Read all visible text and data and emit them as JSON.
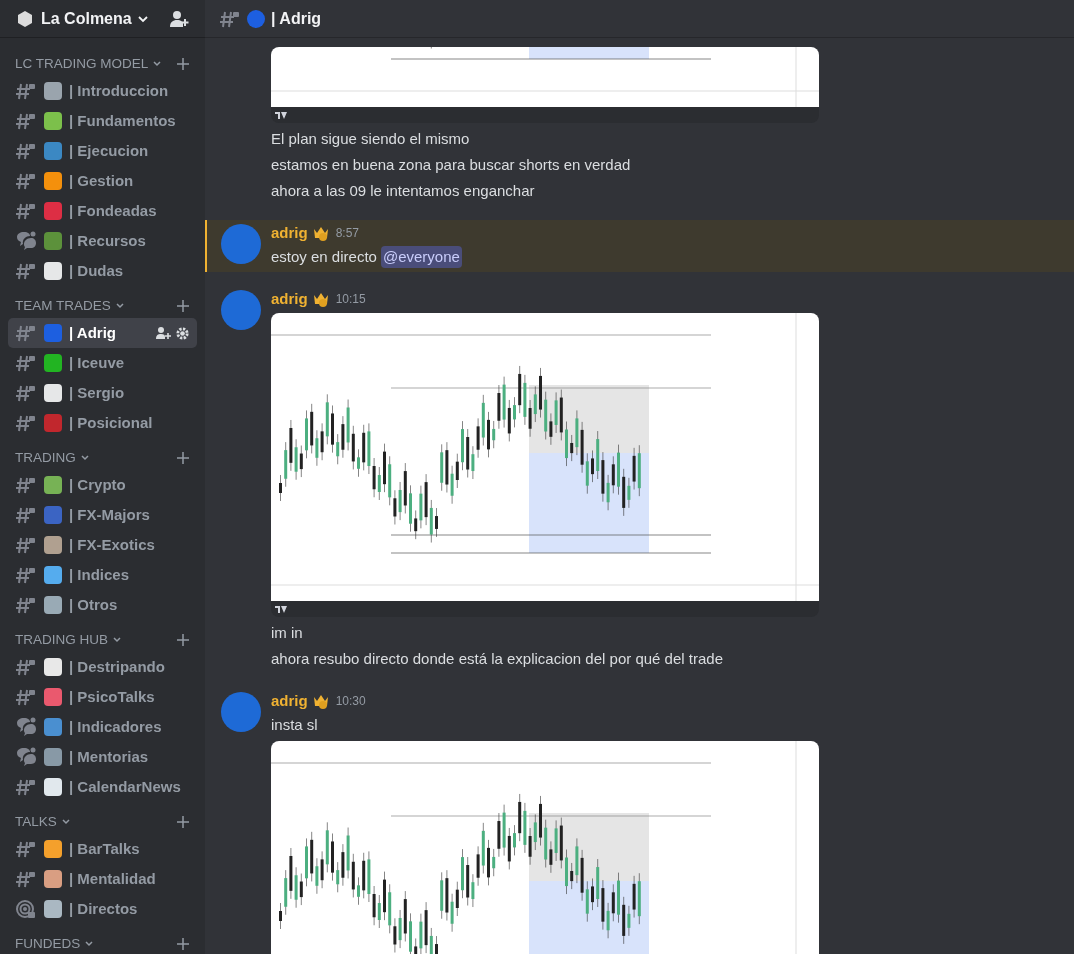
{
  "server": {
    "name": "La Colmena"
  },
  "categories": [
    {
      "name": "LC TRADING MODEL",
      "channels": [
        {
          "name": "| Introduccion",
          "kind": "text",
          "color": "#9aa4ad",
          "selected": false
        },
        {
          "name": "| Fundamentos",
          "kind": "text",
          "color": "#7cc04b",
          "selected": false
        },
        {
          "name": "| Ejecucion",
          "kind": "text",
          "color": "#3b88c3",
          "selected": false
        },
        {
          "name": "| Gestion",
          "kind": "text",
          "color": "#f4900c",
          "selected": false
        },
        {
          "name": "| Fondeadas",
          "kind": "text",
          "color": "#dd2e44",
          "selected": false
        },
        {
          "name": "| Recursos",
          "kind": "forum",
          "color": "#5c913b",
          "selected": false
        },
        {
          "name": "| Dudas",
          "kind": "text",
          "color": "#e6e7e8",
          "selected": false
        }
      ]
    },
    {
      "name": "TEAM TRADES",
      "channels": [
        {
          "name": "| Adrig",
          "kind": "text",
          "color": "#1d5fe0",
          "selected": true
        },
        {
          "name": "| Iceuve",
          "kind": "text",
          "color": "#22b422",
          "selected": false
        },
        {
          "name": "| Sergio",
          "kind": "text",
          "color": "#e6e7e8",
          "selected": false
        },
        {
          "name": "| Posicional",
          "kind": "text",
          "color": "#c1272d",
          "selected": false
        }
      ]
    },
    {
      "name": "TRADING",
      "channels": [
        {
          "name": "| Crypto",
          "kind": "text",
          "color": "#77b255",
          "selected": false
        },
        {
          "name": "| FX-Majors",
          "kind": "text",
          "color": "#3b64c3",
          "selected": false
        },
        {
          "name": "| FX-Exotics",
          "kind": "text",
          "color": "#b0a090",
          "selected": false
        },
        {
          "name": "| Indices",
          "kind": "text",
          "color": "#55acee",
          "selected": false
        },
        {
          "name": "| Otros",
          "kind": "text",
          "color": "#99aab5",
          "selected": false
        }
      ]
    },
    {
      "name": "TRADING HUB",
      "channels": [
        {
          "name": "| Destripando",
          "kind": "text",
          "color": "#e8e8e8",
          "selected": false
        },
        {
          "name": "| PsicoTalks",
          "kind": "text",
          "color": "#ea596e",
          "selected": false
        },
        {
          "name": "| Indicadores",
          "kind": "forum",
          "color": "#4a8fd0",
          "selected": false
        },
        {
          "name": "| Mentorias",
          "kind": "forum",
          "color": "#8899a6",
          "selected": false
        },
        {
          "name": "| CalendarNews",
          "kind": "text",
          "color": "#e1e8ed",
          "selected": false
        }
      ]
    },
    {
      "name": "TALKS",
      "channels": [
        {
          "name": "| BarTalks",
          "kind": "text",
          "color": "#f4a02c",
          "selected": false
        },
        {
          "name": "| Mentalidad",
          "kind": "text",
          "color": "#d99e82",
          "selected": false
        },
        {
          "name": "| Directos",
          "kind": "stage",
          "color": "#aab8c2",
          "selected": false
        }
      ]
    },
    {
      "name": "FUNDEDS"
    }
  ],
  "header": {
    "channel": "| Adrig",
    "kind": "text",
    "color": "#1d5fe0"
  },
  "messages": [
    {
      "kind": "continuation",
      "blocks": [
        {
          "kind": "partial_chart"
        },
        {
          "kind": "text",
          "text": "El plan sigue siendo el mismo"
        },
        {
          "kind": "text",
          "text": "estamos en buena zona para buscar shorts en verdad"
        },
        {
          "kind": "text",
          "text": "ahora a las 09 le intentamos enganchar"
        }
      ]
    },
    {
      "kind": "full",
      "author": "adrig",
      "time": "8:57",
      "mentioned": true,
      "blocks": [
        {
          "kind": "text",
          "text": "estoy en directo",
          "mention": "@everyone"
        }
      ]
    },
    {
      "kind": "full",
      "author": "adrig",
      "time": "10:15",
      "blocks": [
        {
          "kind": "chart"
        },
        {
          "kind": "text",
          "text": "im in"
        },
        {
          "kind": "text",
          "text": "ahora resubo directo donde está la explicacion del por qué del trade"
        }
      ]
    },
    {
      "kind": "full",
      "author": "adrig",
      "time": "10:30",
      "blocks": [
        {
          "kind": "text",
          "text": "insta sl"
        },
        {
          "kind": "chart"
        }
      ]
    }
  ]
}
